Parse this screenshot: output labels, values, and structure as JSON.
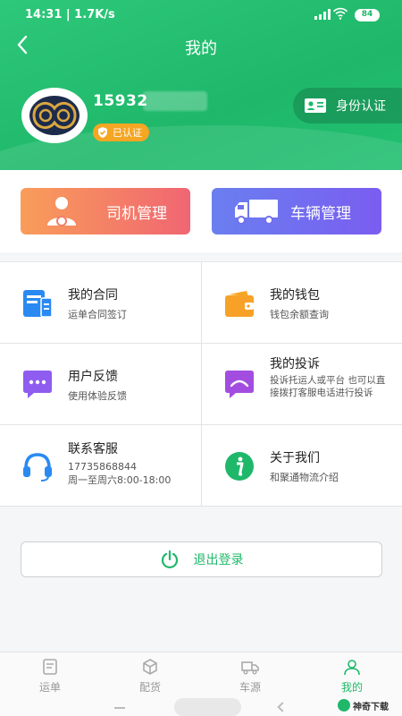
{
  "status_bar": {
    "time": "14:31 | 1.7K/s",
    "battery": "84"
  },
  "header": {
    "title": "我的"
  },
  "profile": {
    "phone": "15932",
    "verified_label": "已认证",
    "id_auth_label": "身份认证"
  },
  "management": {
    "driver_label": "司机管理",
    "vehicle_label": "车辆管理"
  },
  "menu": [
    {
      "title": "我的合同",
      "subtitle": "运单合同签订"
    },
    {
      "title": "我的钱包",
      "subtitle": "钱包余额查询"
    },
    {
      "title": "用户反馈",
      "subtitle": "使用体验反馈"
    },
    {
      "title": "我的投诉",
      "subtitle": "投诉托运人或平台 也可以直接拨打客服电话进行投诉"
    },
    {
      "title": "联系客服",
      "subtitle": "17735868844",
      "subtitle2": "周一至周六8:00-18:00"
    },
    {
      "title": "关于我们",
      "subtitle": "和聚通物流介绍"
    }
  ],
  "logout": {
    "label": "退出登录"
  },
  "tabbar": [
    {
      "label": "运单"
    },
    {
      "label": "配货"
    },
    {
      "label": "车源"
    },
    {
      "label": "我的"
    }
  ],
  "watermark": "神奇下载",
  "colors": {
    "brand_green": "#1fb86a",
    "badge_orange": "#f5a623",
    "driver_btn": "#f06672",
    "vehicle_btn": "#6a7ff0"
  }
}
